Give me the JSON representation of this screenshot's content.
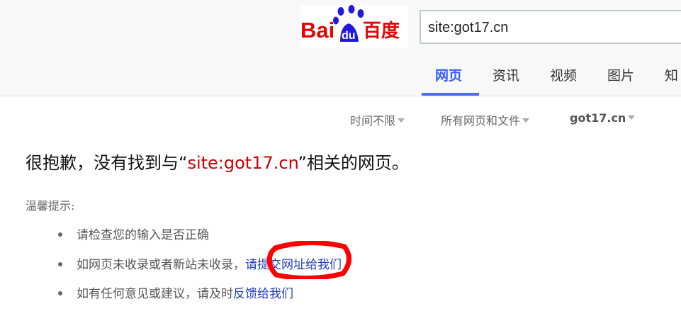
{
  "logo": {
    "bai": "Bai",
    "du": "du",
    "cn": "百度"
  },
  "search": {
    "value": "site:got17.cn"
  },
  "tabs": [
    {
      "label": "网页",
      "active": true
    },
    {
      "label": "资讯"
    },
    {
      "label": "视频"
    },
    {
      "label": "图片"
    },
    {
      "label": "知"
    }
  ],
  "filters": {
    "time": "时间不限",
    "filetype": "所有网页和文件",
    "site": "got17.cn"
  },
  "result": {
    "prefix": "很抱歉，没有找到与“",
    "query": "site:got17.cn",
    "suffix": "”相关的网页。"
  },
  "tips": {
    "title": "温馨提示:",
    "item1": "请检查您的输入是否正确",
    "item2_prefix": "如网页未收录或者新站未收录，",
    "item2_link": "请提交网址给我们",
    "item3_prefix": "如有任何意见或建议，请及时",
    "item3_link": "反馈给我们"
  },
  "colors": {
    "brand_red": "#e10602",
    "brand_blue": "#2319dc",
    "link": "#2440b3",
    "annotation": "#ff0000"
  }
}
